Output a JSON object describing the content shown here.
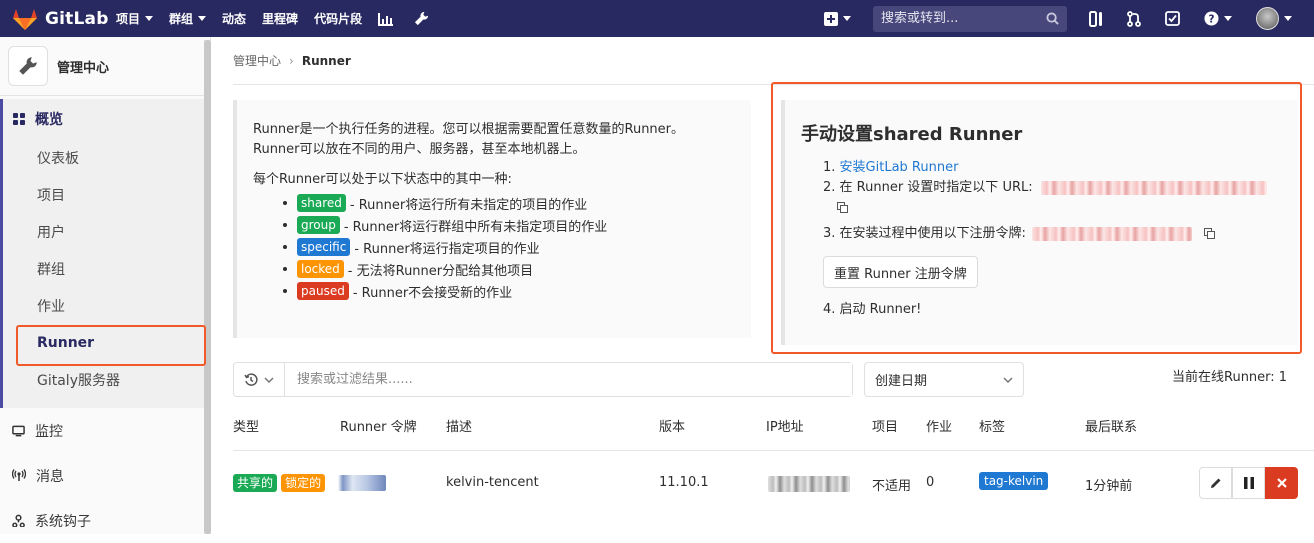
{
  "nav": {
    "brand": "GitLab",
    "items": [
      "项目",
      "群组",
      "动态",
      "里程碑",
      "代码片段"
    ],
    "search_placeholder": "搜索或转到..."
  },
  "sidebar": {
    "title": "管理中心",
    "section": "概览",
    "subitems": [
      "仪表板",
      "项目",
      "用户",
      "群组",
      "作业",
      "Runner",
      "Gitaly服务器"
    ],
    "items": [
      "监控",
      "消息",
      "系统钩子"
    ]
  },
  "breadcrumb": {
    "parent": "管理中心",
    "current": "Runner"
  },
  "info": {
    "intro_line1": "Runner是一个执行任务的进程。您可以根据需要配置任意数量的Runner。",
    "intro_line2": "Runner可以放在不同的用户、服务器，甚至本地机器上。",
    "states_intro": "每个Runner可以处于以下状态中的其中一种:",
    "states": [
      {
        "tag": "shared",
        "text": " - Runner将运行所有未指定的项目的作业"
      },
      {
        "tag": "group",
        "text": " - Runner将运行群组中所有未指定项目的作业"
      },
      {
        "tag": "specific",
        "text": " - Runner将运行指定项目的作业"
      },
      {
        "tag": "locked",
        "text": " - 无法将Runner分配给其他项目"
      },
      {
        "tag": "paused",
        "text": " - Runner不会接受新的作业"
      }
    ]
  },
  "setup": {
    "title": "手动设置shared Runner",
    "step1_num": "1.",
    "step1_link": "安装GitLab Runner",
    "step2": "2. 在 Runner 设置时指定以下 URL:",
    "step3": "3. 在安装过程中使用以下注册令牌:",
    "reset_button": "重置 Runner 注册令牌",
    "step4": "4. 启动 Runner!"
  },
  "filter": {
    "placeholder": "搜索或过滤结果......",
    "sort": "创建日期",
    "online": "当前在线Runner:  1"
  },
  "table": {
    "headers": [
      "类型",
      "Runner 令牌",
      "描述",
      "版本",
      "IP地址",
      "项目",
      "作业",
      "标签",
      "最后联系"
    ],
    "row": {
      "type_shared": "共享的",
      "type_locked": "锁定的",
      "description": "kelvin-tencent",
      "version": "11.10.1",
      "projects": "不适用",
      "jobs": "0",
      "tag": "tag-kelvin",
      "last_contact": "1分钟前"
    }
  },
  "colors": {
    "nav_bg": "#292961",
    "shared": "#1aaa55",
    "blue": "#1f78d1",
    "locked": "#fc9403",
    "danger": "#db3b21",
    "highlight": "#f05a28"
  }
}
